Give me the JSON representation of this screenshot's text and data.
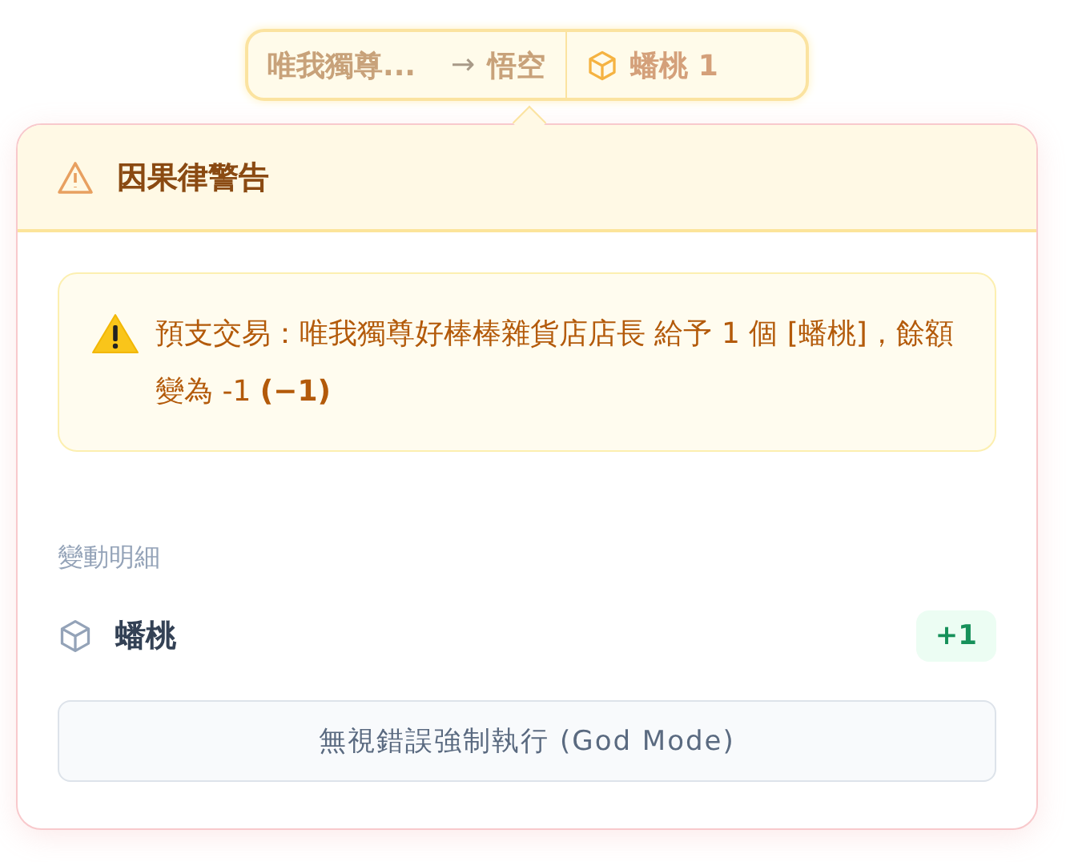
{
  "transfer_chip": {
    "from": "唯我獨尊...",
    "arrow": "→",
    "to": "悟空",
    "item": "蟠桃 1"
  },
  "popover": {
    "title": "因果律警告",
    "alert": "預支交易：唯我獨尊好棒棒雜貨店店長 給予 1 個 [蟠桃]，餘額變為 -1 **(−1)**",
    "details_label": "變動明細",
    "changes": [
      {
        "name": "蟠桃",
        "delta": "+1"
      }
    ],
    "force_button": "無視錯誤強制執行 (God Mode)"
  }
}
